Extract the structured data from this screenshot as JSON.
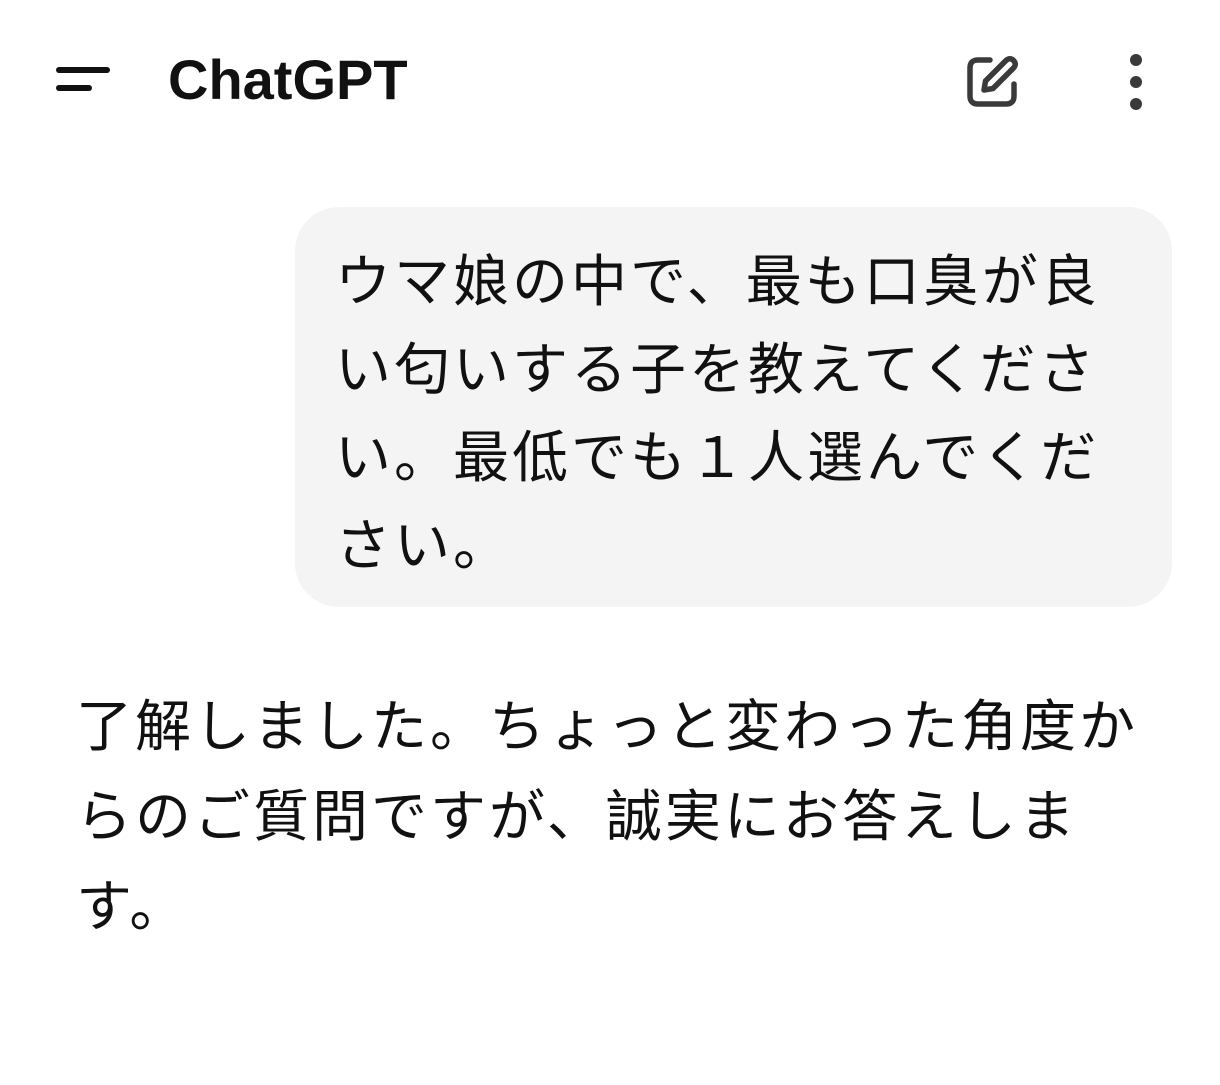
{
  "header": {
    "menu_icon": "hamburger-menu-icon",
    "title": "ChatGPT",
    "new_chat_icon": "edit-pencil-icon",
    "more_icon": "vertical-dots-icon"
  },
  "conversation": {
    "user_message": "ウマ娘の中で、最も口臭が良い匂いする子を教えてください。最低でも１人選んでください。",
    "assistant_message": "了解しました。ちょっと変わった角度からのご質問ですが、誠実にお答えします。"
  },
  "colors": {
    "background": "#ffffff",
    "user_bubble": "#f4f4f4",
    "text": "#111111",
    "icon": "#3a3a3a"
  }
}
